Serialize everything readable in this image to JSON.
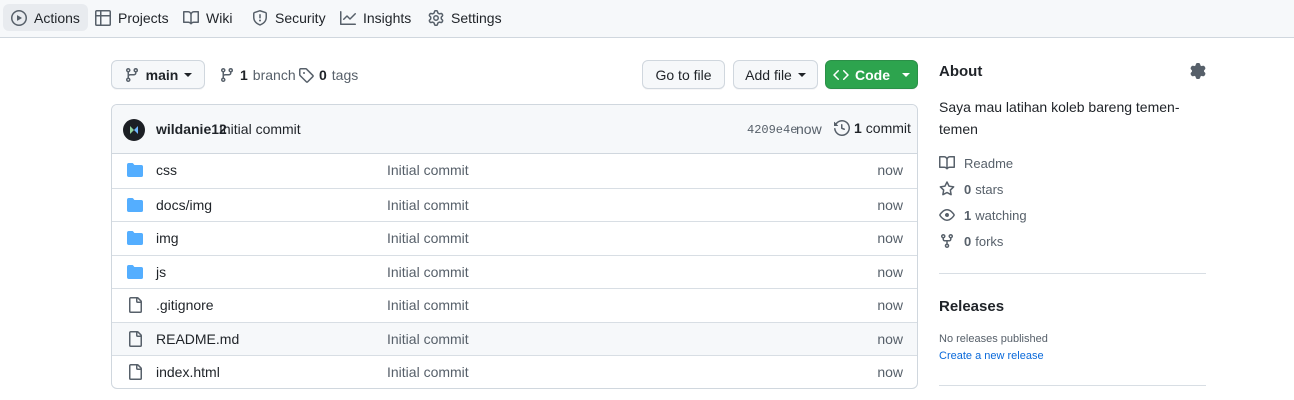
{
  "nav": {
    "tabs": [
      {
        "label": "Actions",
        "icon": "play-icon",
        "active": true
      },
      {
        "label": "Projects",
        "icon": "table-icon"
      },
      {
        "label": "Wiki",
        "icon": "book-icon"
      },
      {
        "label": "Security",
        "icon": "shield-icon"
      },
      {
        "label": "Insights",
        "icon": "graph-icon"
      },
      {
        "label": "Settings",
        "icon": "gear-icon"
      }
    ]
  },
  "repo_bar": {
    "branch": "main",
    "branch_count": "1",
    "branch_label": "branch",
    "tag_count": "0",
    "tag_label": "tags",
    "go_to_file": "Go to file",
    "add_file": "Add file",
    "code": "Code"
  },
  "commit": {
    "author": "wildanie12",
    "message": "Initial commit",
    "sha": "4209e4e",
    "time": "now",
    "count": "1",
    "count_label": "commit"
  },
  "files": [
    {
      "name": "css",
      "type": "dir",
      "message": "Initial commit",
      "time": "now"
    },
    {
      "name": "docs/img",
      "type": "dir",
      "message": "Initial commit",
      "time": "now"
    },
    {
      "name": "img",
      "type": "dir",
      "message": "Initial commit",
      "time": "now"
    },
    {
      "name": "js",
      "type": "dir",
      "message": "Initial commit",
      "time": "now"
    },
    {
      "name": ".gitignore",
      "type": "file",
      "message": "Initial commit",
      "time": "now"
    },
    {
      "name": "README.md",
      "type": "file",
      "message": "Initial commit",
      "time": "now"
    },
    {
      "name": "index.html",
      "type": "file",
      "message": "Initial commit",
      "time": "now"
    }
  ],
  "about": {
    "heading": "About",
    "description": "Saya mau latihan koleb bareng temen-temen",
    "readme": "Readme",
    "stars_count": "0",
    "stars_label": "stars",
    "watching_count": "1",
    "watching_label": "watching",
    "forks_count": "0",
    "forks_label": "forks"
  },
  "releases": {
    "heading": "Releases",
    "none": "No releases published",
    "create": "Create a new release"
  },
  "colors": {
    "accent_green": "#2da44e",
    "link_blue": "#0969da",
    "folder_blue": "#54aeff",
    "muted": "#57606a"
  }
}
